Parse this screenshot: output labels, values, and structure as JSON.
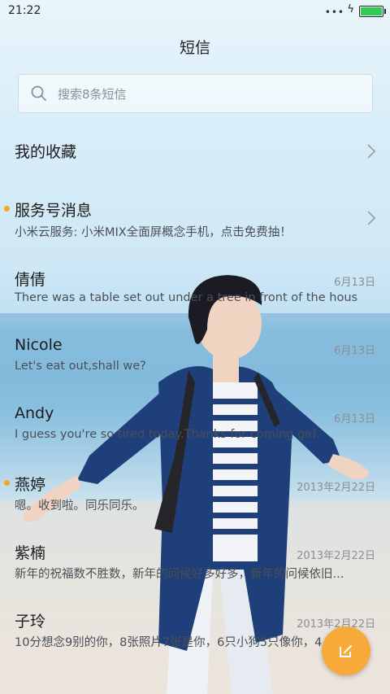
{
  "status_bar": {
    "time": "21:22",
    "dots": "•••",
    "battery_level": 1.0,
    "battery_color": "#2ecc55"
  },
  "header": {
    "title": "短信"
  },
  "search": {
    "placeholder": "搜索8条短信"
  },
  "favorites": {
    "label": "我的收藏"
  },
  "service": {
    "label": "服务号消息",
    "preview": "小米云服务: 小米MIX全面屏概念手机，点击免费抽！",
    "unread": true
  },
  "conversations": [
    {
      "name": "倩倩",
      "preview": "There was a table set out under a tree in front of the hous",
      "date": "6月13日",
      "unread": false
    },
    {
      "name": "Nicole",
      "preview": "Let's eat out,shall we?",
      "date": "6月13日",
      "unread": false
    },
    {
      "name": "Andy",
      "preview": "I guess you're so tired today.Thanks for coming girl.",
      "date": "6月13日",
      "unread": false
    },
    {
      "name": "燕婷",
      "preview": "嗯。收到啦。同乐同乐。",
      "date": "2013年2月22日",
      "unread": true
    },
    {
      "name": "紫楠",
      "preview": "新年的祝福数不胜数，新年的问候好多好多，新年的问候依旧...",
      "date": "2013年2月22日",
      "unread": false
    },
    {
      "name": "子玲",
      "preview": "10分想念9别的你，8张照片7张是你，6只小狗5只像你，4",
      "date": "2013年2月22日",
      "unread": false
    }
  ],
  "colors": {
    "accent": "#f7a93a",
    "unread_dot": "#f5a623"
  },
  "icons": {
    "search": "search-icon",
    "chevron": "chevron-right-icon",
    "compose": "compose-icon"
  }
}
